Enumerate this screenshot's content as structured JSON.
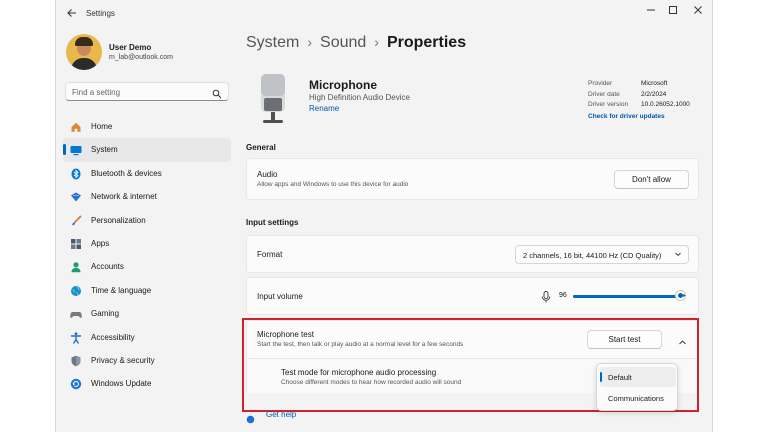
{
  "window": {
    "title": "Settings",
    "back_icon": "back-arrow-icon",
    "controls": [
      "minimize-icon",
      "maximize-icon",
      "close-icon"
    ]
  },
  "user": {
    "name": "User Demo",
    "email": "m_lab@outlook.com"
  },
  "search": {
    "placeholder": "Find a setting",
    "icon": "search-icon"
  },
  "sidebar": {
    "items": [
      {
        "label": "Home",
        "icon": "home-icon",
        "color": "#c0762b"
      },
      {
        "label": "System",
        "icon": "system-icon",
        "color": "#0078d4",
        "active": true
      },
      {
        "label": "Bluetooth & devices",
        "icon": "bluetooth-icon",
        "color": "#0078d4"
      },
      {
        "label": "Network & internet",
        "icon": "network-icon",
        "color": "#2b6fd6"
      },
      {
        "label": "Personalization",
        "icon": "brush-icon",
        "color": "#d07a3a"
      },
      {
        "label": "Apps",
        "icon": "apps-icon",
        "color": "#4a5a6a"
      },
      {
        "label": "Accounts",
        "icon": "accounts-icon",
        "color": "#1c9e6c"
      },
      {
        "label": "Time & language",
        "icon": "globe-icon",
        "color": "#1a8fc9"
      },
      {
        "label": "Gaming",
        "icon": "gaming-icon",
        "color": "#7a7a7a"
      },
      {
        "label": "Accessibility",
        "icon": "accessibility-icon",
        "color": "#1a6fd6"
      },
      {
        "label": "Privacy & security",
        "icon": "shield-icon",
        "color": "#6b7585"
      },
      {
        "label": "Windows Update",
        "icon": "update-icon",
        "color": "#1a78d6"
      }
    ]
  },
  "breadcrumb": {
    "items": [
      "System",
      "Sound",
      "Properties"
    ],
    "separator": "›"
  },
  "device": {
    "name": "Microphone",
    "subtitle": "High Definition Audio Device",
    "rename_label": "Rename",
    "info": [
      {
        "key": "Provider",
        "value": "Microsoft"
      },
      {
        "key": "Driver date",
        "value": "2/2/2024"
      },
      {
        "key": "Driver version",
        "value": "10.0.26052.1000"
      }
    ],
    "driver_link": "Check for driver updates"
  },
  "general": {
    "title": "General",
    "audio": {
      "title": "Audio",
      "desc": "Allow apps and Windows to use this device for audio",
      "button": "Don't allow"
    }
  },
  "input": {
    "title": "Input settings",
    "format": {
      "label": "Format",
      "value": "2 channels, 16 bit, 44100 Hz (CD Quality)"
    },
    "volume": {
      "label": "Input volume",
      "value": "96",
      "level_percent": 96
    },
    "mic_test": {
      "title": "Microphone test",
      "desc": "Start the test, then talk or play audio at a normal level for a few seconds",
      "button": "Start test",
      "test_mode": {
        "title": "Test mode for microphone audio processing",
        "desc": "Choose different modes to hear how recorded audio will sound",
        "options": [
          "Default",
          "Communications"
        ],
        "selected": "Default"
      }
    }
  },
  "footer": {
    "help": "Get help"
  },
  "colors": {
    "accent": "#0067c0",
    "highlight": "#d0212e"
  }
}
